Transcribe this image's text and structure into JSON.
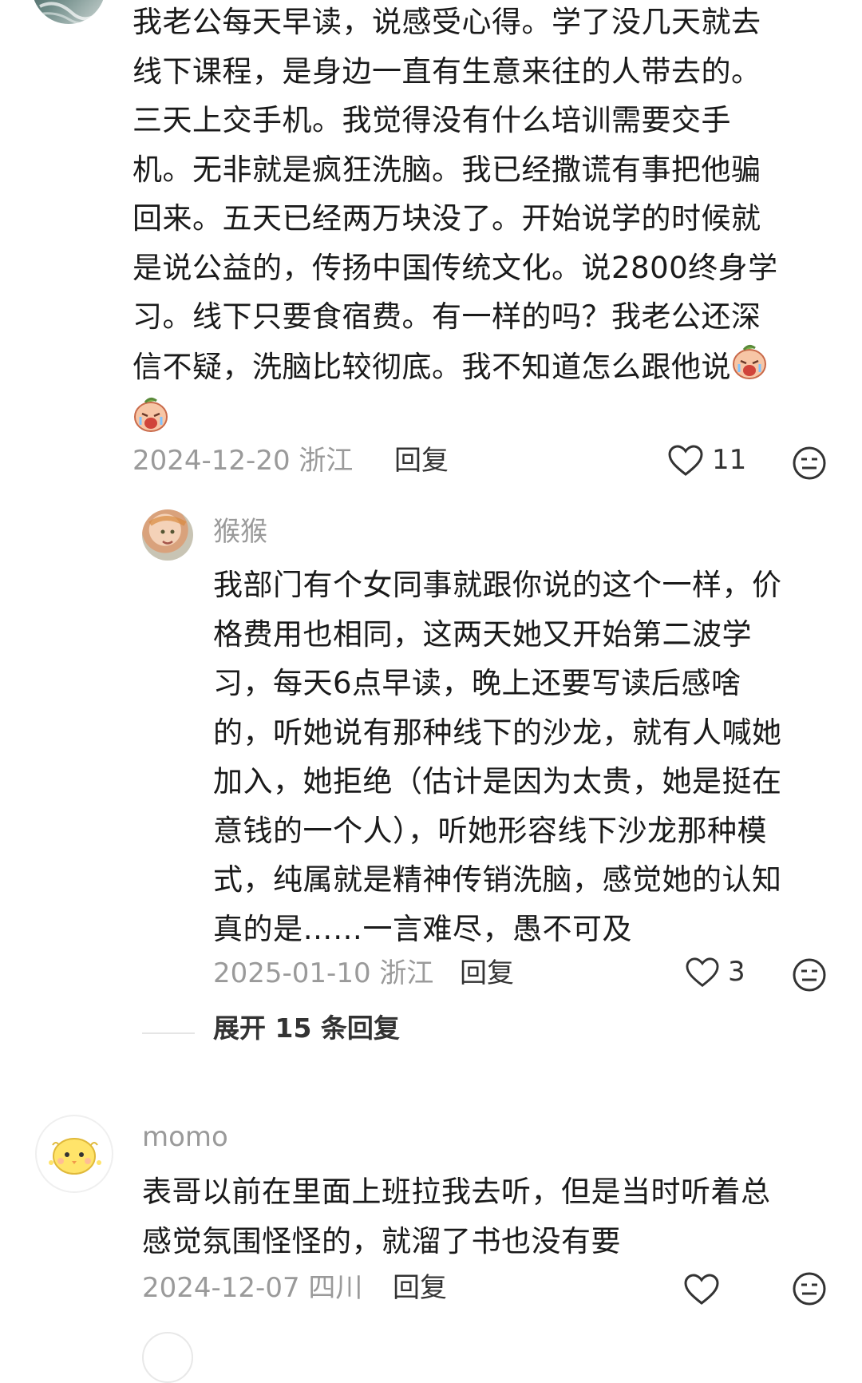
{
  "comment1": {
    "lines": [
      "我老公每天早读，说感受心得。学了没几天就去",
      "线下课程，是身边一直有生意来往的人带去的。",
      "三天上交手机。我觉得没有什么培训需要交手",
      "机。无非就是疯狂洗脑。我已经撒谎有事把他骗",
      "回来。五天已经两万块没了。开始说学的时候就",
      "是说公益的，传扬中国传统文化。说2800终身学",
      "习。线下只要食宿费。有一样的吗？我老公还深",
      "信不疑，洗脑比较彻底。我不知道怎么跟他说"
    ],
    "date_location": "2024-12-20 浙江",
    "reply_label": "回复",
    "like_count": "11"
  },
  "reply1": {
    "username": "猴猴",
    "lines": [
      "我部门有个女同事就跟你说的这个一样，价",
      "格费用也相同，这两天她又开始第二波学",
      "习，每天6点早读，晚上还要写读后感啥",
      "的，听她说有那种线下的沙龙，就有人喊她",
      "加入，她拒绝（估计是因为太贵，她是挺在",
      "意钱的一个人），听她形容线下沙龙那种模",
      "式，纯属就是精神传销洗脑，感觉她的认知",
      "真的是……一言难尽，愚不可及"
    ],
    "date_location": "2025-01-10 浙江",
    "reply_label": "回复",
    "like_count": "3",
    "expand_label": "展开 15 条回复"
  },
  "comment2": {
    "username": "momo",
    "lines": [
      "表哥以前在里面上班拉我去听，但是当时听着总",
      "感觉氛围怪怪的，就溜了书也没有要"
    ],
    "date_location": "2024-12-07 四川",
    "reply_label": "回复",
    "like_count": ""
  },
  "colors": {
    "text": "#1a1a1a",
    "meta": "#9a9a9a",
    "icon": "#333333"
  },
  "icons": [
    "heart-outline-icon",
    "neutral-face-icon",
    "crying-emoji-icon"
  ]
}
